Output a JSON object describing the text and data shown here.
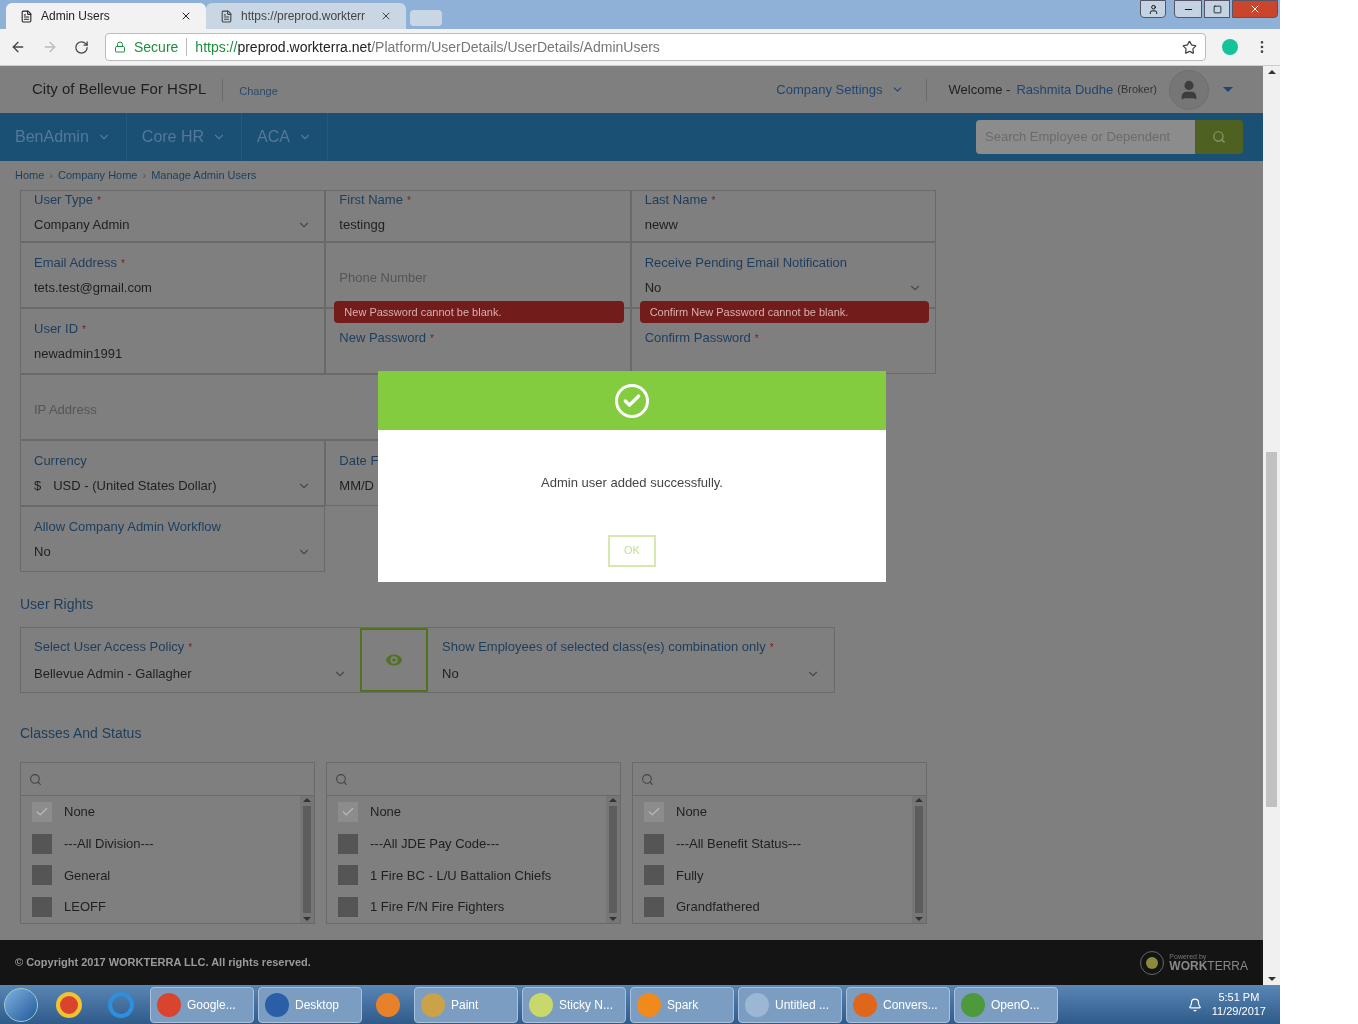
{
  "browser": {
    "tabs": [
      {
        "title": "Admin Users",
        "selected": true
      },
      {
        "title": "https://preprod.workterr",
        "selected": false
      }
    ],
    "secure_label": "Secure",
    "url_host": "https://preprod.workterra.net",
    "url_path": "/Platform/UserDetails/UserDetails/AdminUsers"
  },
  "header": {
    "company": "City of Bellevue For HSPL",
    "change_link": "Change",
    "settings_menu": "Company Settings",
    "welcome": "Welcome -",
    "user_name": "Rashmita Dudhe",
    "user_role": "(Broker)"
  },
  "nav": {
    "menus": [
      "BenAdmin",
      "Core HR",
      "ACA"
    ],
    "search_placeholder": "Search Employee or Dependent"
  },
  "breadcrumbs": {
    "separator": "›",
    "items": [
      "Home",
      "Company Home",
      "Manage Admin Users"
    ]
  },
  "required_mark": "*",
  "form": {
    "rows": [
      {
        "fields": [
          {
            "label": "User Type",
            "required": true,
            "kind": "select",
            "value": "Company Admin"
          },
          {
            "label": "First Name",
            "required": true,
            "kind": "text",
            "value": "testingg"
          },
          {
            "label": "Last Name",
            "required": true,
            "kind": "text",
            "value": "neww"
          }
        ]
      },
      {
        "fields": [
          {
            "label": "Email Address",
            "required": true,
            "kind": "text",
            "value": "tets.test@gmail.com"
          },
          {
            "kind": "text",
            "placeholder": "Phone Number"
          },
          {
            "label": "Receive Pending Email Notification",
            "required": false,
            "kind": "select",
            "value": "No"
          }
        ]
      },
      {
        "fields": [
          {
            "label": "User ID",
            "required": true,
            "kind": "text",
            "value": "newadmin1991"
          },
          {
            "label": "New Password",
            "required": true,
            "kind": "text",
            "error": "New Password cannot be blank."
          },
          {
            "label": "Confirm Password",
            "required": true,
            "kind": "text",
            "error": "Confirm New Password cannot be blank."
          }
        ]
      },
      {
        "fields": [
          {
            "kind": "text",
            "placeholder": "IP Address"
          }
        ]
      },
      {
        "fields": [
          {
            "label": "Currency",
            "required": false,
            "kind": "select",
            "prefix": "$",
            "value": "USD - (United States Dollar)"
          },
          {
            "label": "Date F",
            "required": false,
            "kind": "text",
            "value": "MM/D"
          }
        ]
      },
      {
        "fields": [
          {
            "label": "Allow Company Admin Workflow",
            "required": false,
            "kind": "select",
            "value": "No"
          }
        ]
      }
    ]
  },
  "user_rights": {
    "title": "User Rights",
    "policy": {
      "label": "Select User Access Policy",
      "required": true,
      "value": "Bellevue Admin - Gallagher"
    },
    "show_employees": {
      "label": "Show Employees of selected class(es) combination only",
      "required": true,
      "value": "No"
    }
  },
  "classes": {
    "title": "Classes And Status",
    "lists": [
      {
        "items": [
          {
            "label": "None",
            "checked": true
          },
          {
            "label": "---All Division---",
            "checked": false
          },
          {
            "label": "General",
            "checked": false
          },
          {
            "label": "LEOFF",
            "checked": false
          }
        ]
      },
      {
        "items": [
          {
            "label": "None",
            "checked": true
          },
          {
            "label": "---All JDE Pay Code---",
            "checked": false
          },
          {
            "label": "1 Fire BC - L/U Battalion Chiefs",
            "checked": false
          },
          {
            "label": "1 Fire F/N Fire Fighters",
            "checked": false
          }
        ]
      },
      {
        "items": [
          {
            "label": "None",
            "checked": true
          },
          {
            "label": "---All Benefit Status---",
            "checked": false
          },
          {
            "label": "Fully",
            "checked": false
          },
          {
            "label": "Grandfathered",
            "checked": false
          }
        ]
      }
    ]
  },
  "modal": {
    "message": "Admin user added successfully.",
    "ok": "OK"
  },
  "footer": {
    "copyright": "© Copyright 2017 WORKTERRA LLC. All rights reserved.",
    "powered_by": "Powered by",
    "brand": "**WORK**TERRA"
  },
  "taskbar": {
    "items": [
      {
        "label": "Google...",
        "kind": "chrome"
      },
      {
        "label": "Desktop",
        "kind": "desktop"
      },
      {
        "kind": "media"
      },
      {
        "label": "Paint",
        "kind": "paint"
      },
      {
        "label": "Sticky N...",
        "kind": "sticky"
      },
      {
        "label": "Spark",
        "kind": "spark"
      },
      {
        "label": "Untitled ...",
        "kind": "notepad"
      },
      {
        "label": "Convers...",
        "kind": "firefox"
      },
      {
        "label": "OpenO...",
        "kind": "office"
      }
    ],
    "time": "5:51 PM",
    "date": "11/29/2017"
  }
}
